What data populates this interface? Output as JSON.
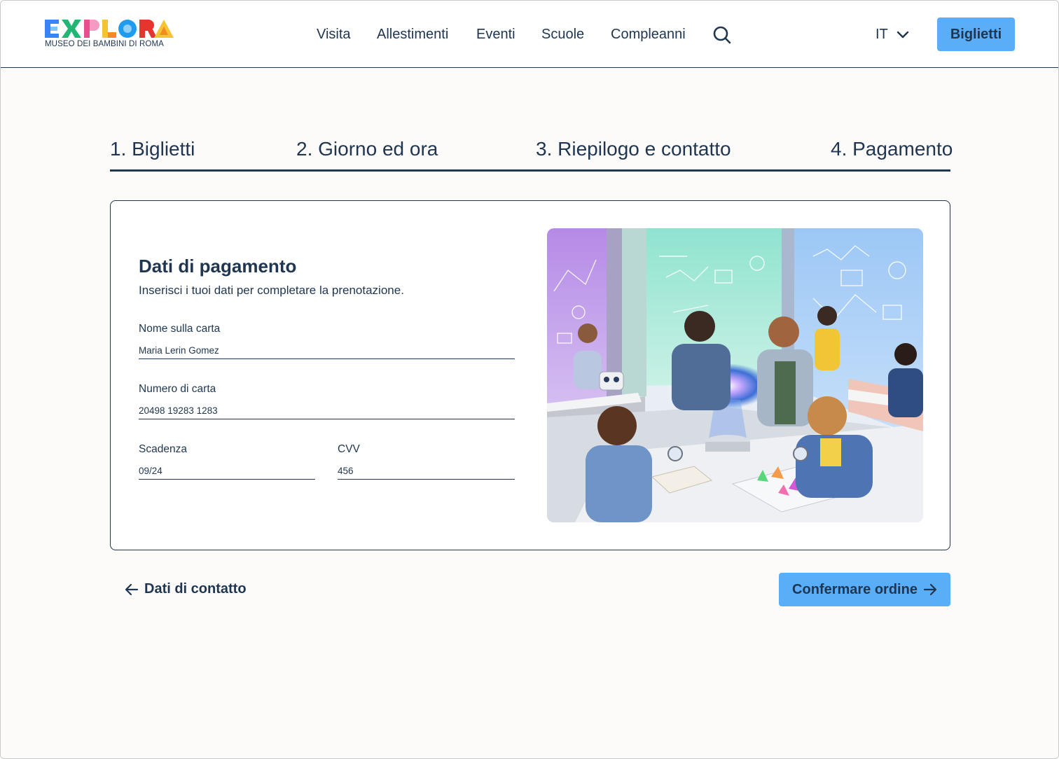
{
  "header": {
    "logo_text": "EXPLORA",
    "logo_subtitle": "MUSEO DEI BAMBINI DI ROMA",
    "logo_colors": [
      "#3b82f6",
      "#22b573",
      "#e94e8e",
      "#1f9bf0",
      "#e6342f",
      "#f7c234"
    ],
    "nav": [
      {
        "label": "Visita"
      },
      {
        "label": "Allestimenti"
      },
      {
        "label": "Eventi"
      },
      {
        "label": "Scuole"
      },
      {
        "label": "Compleanni"
      }
    ],
    "search_icon": "search-icon",
    "language": "IT",
    "tickets_button": "Biglietti"
  },
  "steps": [
    {
      "label": "1. Biglietti"
    },
    {
      "label": "2. Giorno ed ora"
    },
    {
      "label": "3. Riepilogo e contatto"
    },
    {
      "label": "4. Pagamento"
    }
  ],
  "payment": {
    "title": "Dati di pagamento",
    "subtitle": "Inserisci i tuoi dati per completare la prenotazione.",
    "card_name": {
      "label": "Nome sulla carta",
      "value": "Maria Lerin Gomez"
    },
    "card_number": {
      "label": "Numero di carta",
      "value": "20498 19283 1283"
    },
    "expiry": {
      "label": "Scadenza",
      "value": "09/24"
    },
    "cvv": {
      "label": "CVV",
      "value": "456"
    }
  },
  "actions": {
    "back_label": "Dati di contatto",
    "confirm_label": "Confermare ordine"
  },
  "colors": {
    "primary_text": "#1f3550",
    "accent": "#5aaef7",
    "background": "#fcfbf9"
  }
}
